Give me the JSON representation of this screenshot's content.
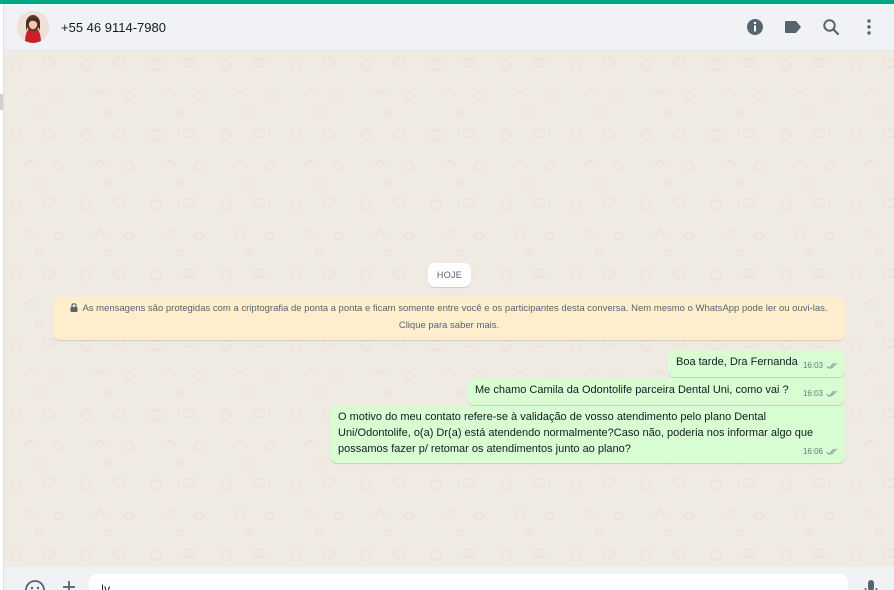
{
  "header": {
    "contact_name": "+55 46 9114-7980"
  },
  "chat": {
    "date_label": "HOJE",
    "encryption_notice": "As mensagens são protegidas com a criptografia de ponta a ponta e ficam somente entre você e os participantes desta conversa. Nem mesmo o WhatsApp pode ler ou ouvi-las. Clique para saber mais.",
    "messages": [
      {
        "text": "Boa tarde, Dra Fernanda",
        "time": "16:03"
      },
      {
        "text": "Me chamo Camila da Odontolife parceira Dental Uni, como vai ?",
        "time": "16:03"
      },
      {
        "text": "O motivo do meu contato refere-se à validação de vosso atendimento pelo plano Dental Uni/Odontolife, o(a) Dr(a) está atendendo normalmente?Caso não, poderia nos informar algo que possamos fazer p/ retomar os atendimentos junto ao plano?",
        "time": "16:06"
      }
    ]
  },
  "footer": {
    "input_value": "|v"
  },
  "colors": {
    "accent": "#00a884",
    "outgoing_bubble": "#d9fdd3",
    "notice_bg": "#ffeecd",
    "chat_bg": "#efeae2",
    "read_ticks": "#53bdeb"
  },
  "icons": [
    "contact-info-icon",
    "label-icon",
    "search-icon",
    "menu-dots-icon",
    "lock-icon",
    "double-check-icon",
    "emoji-icon",
    "plus-icon",
    "mic-icon"
  ]
}
